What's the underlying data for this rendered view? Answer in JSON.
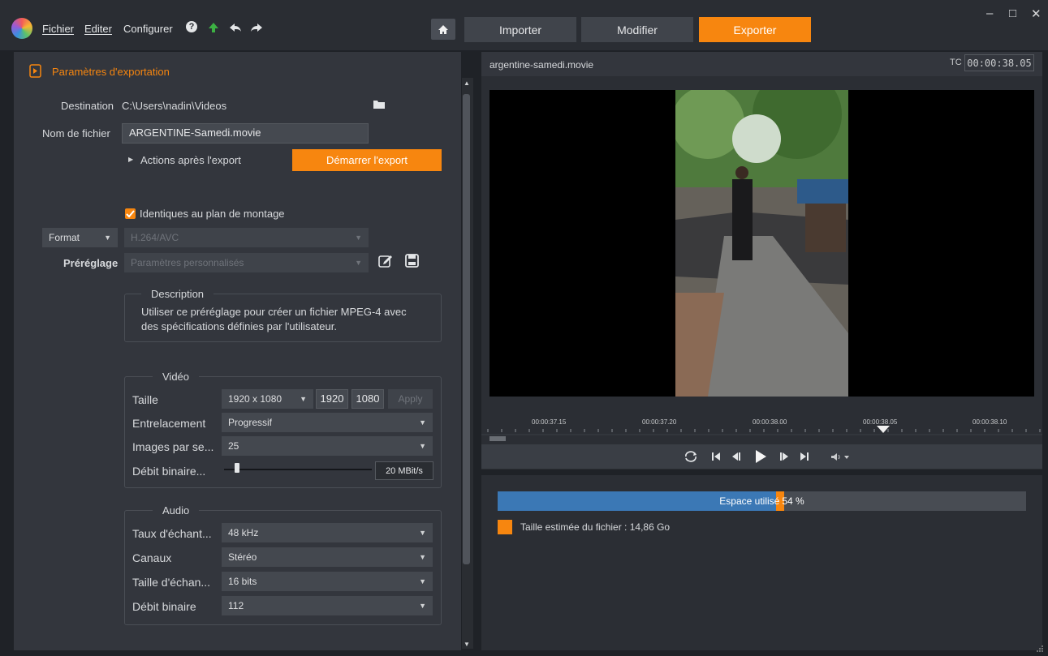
{
  "menu": {
    "fichier": "Fichier",
    "editer": "Editer",
    "configurer": "Configurer"
  },
  "tabs": {
    "importer": "Importer",
    "modifier": "Modifier",
    "exporter": "Exporter"
  },
  "window_controls": {
    "minimize": "–",
    "maximize": "□",
    "close": "✕"
  },
  "export": {
    "section_title": "Paramètres d'exportation",
    "destination_label": "Destination",
    "destination_value": "C:\\Users\\nadin\\Videos",
    "filename_label": "Nom de fichier",
    "filename_value": "ARGENTINE-Samedi.movie",
    "actions_label": "Actions après l'export",
    "start_button": "Démarrer l'export",
    "same_as_timeline": "Identiques au plan de montage",
    "format_label": "Format",
    "format_value": "H.264/AVC",
    "preset_label": "Préréglage",
    "preset_value": "Paramètres personnalisés",
    "description_legend": "Description",
    "description_text_1": "Utiliser ce préréglage pour créer un fichier MPEG-4 avec",
    "description_text_2": "des spécifications définies par l'utilisateur."
  },
  "video": {
    "legend": "Vidéo",
    "size_label": "Taille",
    "size_value": "1920 x 1080",
    "width": "1920",
    "height": "1080",
    "apply": "Apply",
    "interlace_label": "Entrelacement",
    "interlace_value": "Progressif",
    "fps_label": "Images par se...",
    "fps_value": "25",
    "bitrate_label": "Débit binaire...",
    "bitrate_value": "20 MBit/s",
    "bitrate_fraction": 0.07
  },
  "audio": {
    "legend": "Audio",
    "samplerate_label": "Taux d'échant...",
    "samplerate_value": "48 kHz",
    "channels_label": "Canaux",
    "channels_value": "Stéréo",
    "samplesize_label": "Taille d'échan...",
    "samplesize_value": "16 bits",
    "bitrate_label": "Débit binaire",
    "bitrate_value": "112"
  },
  "preview": {
    "filename": "argentine-samedi.movie",
    "tc_label": "TC",
    "timecode": "00:00:38.05",
    "timeline_ticks": [
      "00:00:37.15",
      "00:00:37.20",
      "00:00:38.00",
      "00:00:38.05",
      "00:00:38.10"
    ],
    "playhead_tick": "00:00:38.05"
  },
  "storage": {
    "used_label": "Espace utilisé",
    "used_percent": "54 %",
    "used_fraction": 0.54,
    "estimated_label": "Taille estimée du fichier : 14,86 Go",
    "bar_color": "#3b78b5",
    "estimate_color": "#f7860f"
  },
  "colors": {
    "accent": "#f7860f",
    "panel": "#33363d",
    "background": "#1f2227"
  }
}
